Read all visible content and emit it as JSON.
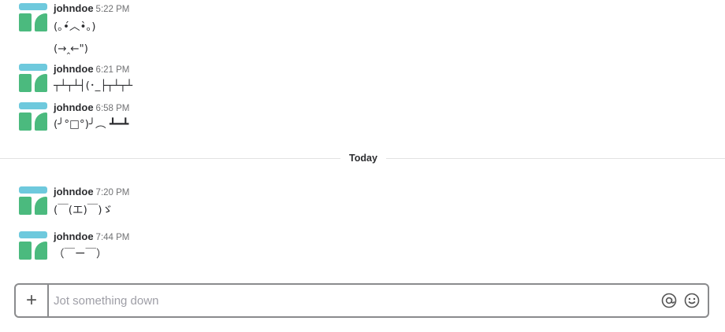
{
  "messages_before": [
    {
      "user": "johndoe",
      "time": "5:22 PM",
      "lines": [
        "(｡•́︿•̀｡)",
        "(→‸←\")"
      ]
    },
    {
      "user": "johndoe",
      "time": "6:21 PM",
      "lines": [
        "┬┴┬┴┤(･_├┬┴┬┴"
      ]
    },
    {
      "user": "johndoe",
      "time": "6:58 PM",
      "lines": [
        "(╯°□°)╯︵ ┻━┻"
      ]
    }
  ],
  "divider": {
    "label": "Today"
  },
  "messages_after": [
    {
      "user": "johndoe",
      "time": "7:20 PM",
      "lines": [
        "(￣(エ)￣)ゞ"
      ]
    },
    {
      "user": "johndoe",
      "time": "7:44 PM",
      "lines": [
        "（￣ー￣）"
      ]
    }
  ],
  "composer": {
    "placeholder": "Jot something down",
    "add_label": "+",
    "icons": [
      "at-sign-icon",
      "emoji-icon"
    ]
  }
}
